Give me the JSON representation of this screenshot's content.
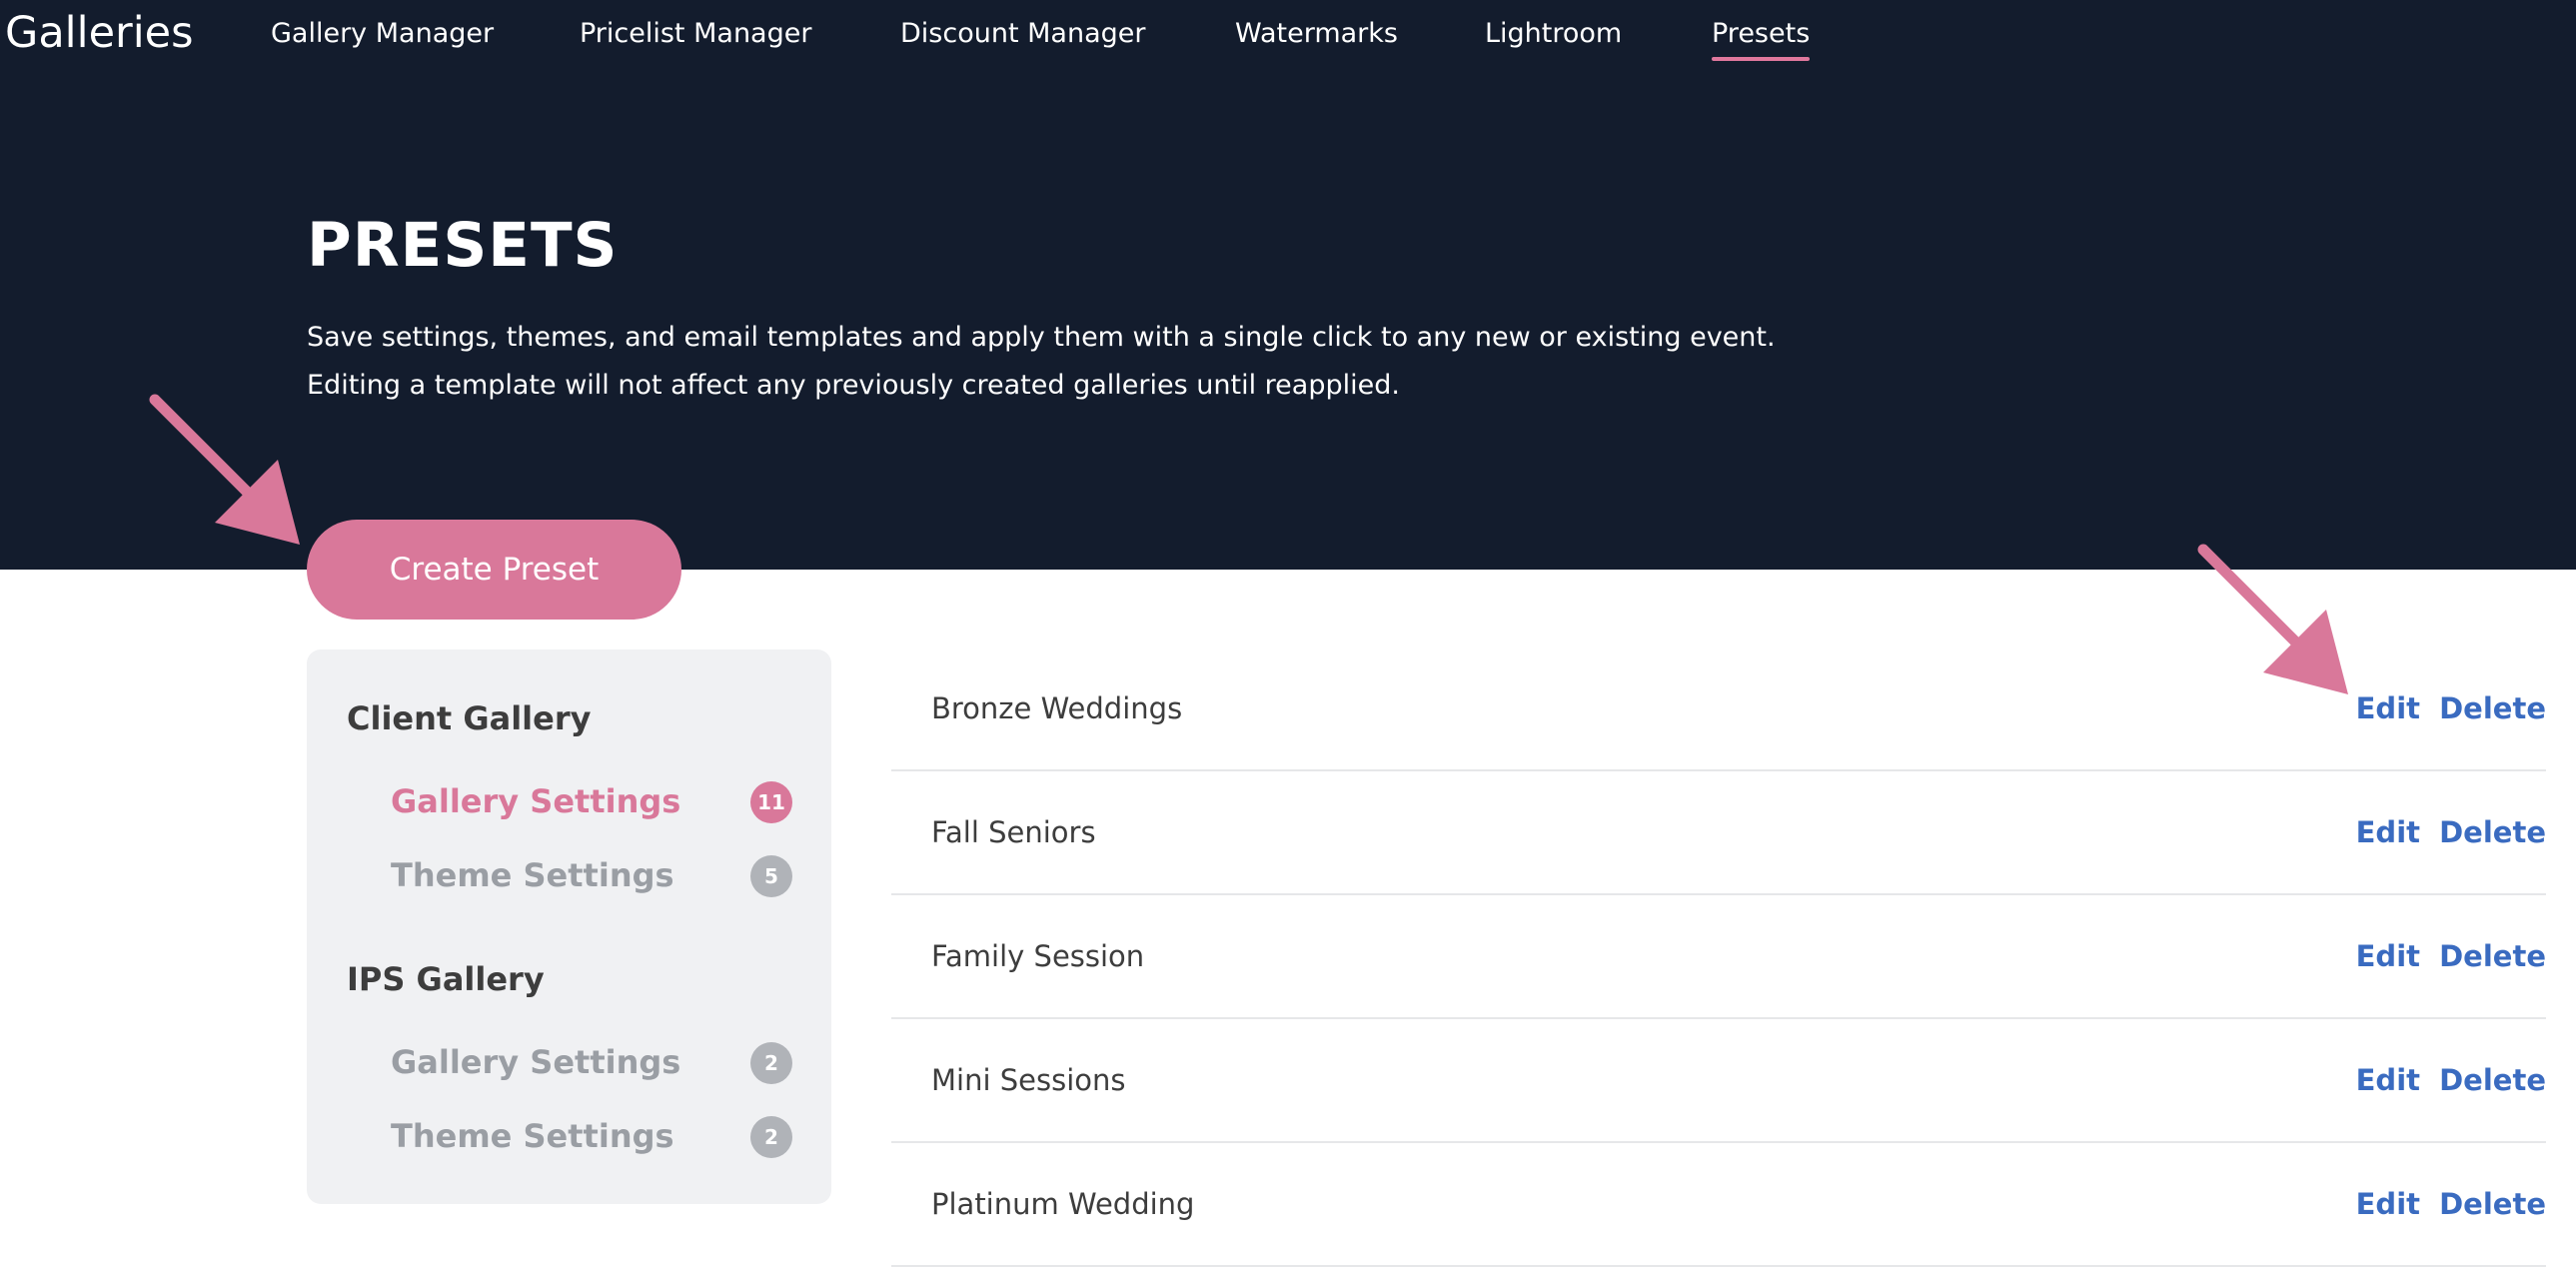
{
  "brand": "Galleries",
  "nav": [
    {
      "label": "Gallery Manager"
    },
    {
      "label": "Pricelist Manager"
    },
    {
      "label": "Discount Manager"
    },
    {
      "label": "Watermarks"
    },
    {
      "label": "Lightroom"
    },
    {
      "label": "Presets",
      "active": true
    }
  ],
  "page": {
    "title": "PRESETS",
    "description_line1": "Save settings, themes, and email templates and apply them with a single click to any new or existing event.",
    "description_line2": "Editing a template will not affect any previously created galleries until reapplied.",
    "create_label": "Create Preset"
  },
  "sidebar": {
    "groups": [
      {
        "heading": "Client Gallery",
        "items": [
          {
            "label": "Gallery Settings",
            "count": "11",
            "active": true
          },
          {
            "label": "Theme Settings",
            "count": "5"
          }
        ]
      },
      {
        "heading": "IPS Gallery",
        "items": [
          {
            "label": "Gallery Settings",
            "count": "2"
          },
          {
            "label": "Theme Settings",
            "count": "2"
          }
        ]
      }
    ]
  },
  "presets": [
    {
      "name": "Bronze Weddings",
      "edit": "Edit",
      "delete": "Delete"
    },
    {
      "name": "Fall Seniors",
      "edit": "Edit",
      "delete": "Delete"
    },
    {
      "name": "Family Session",
      "edit": "Edit",
      "delete": "Delete"
    },
    {
      "name": "Mini Sessions",
      "edit": "Edit",
      "delete": "Delete"
    },
    {
      "name": "Platinum Wedding",
      "edit": "Edit",
      "delete": "Delete"
    }
  ],
  "colors": {
    "header_bg": "#131c2d",
    "accent_pink": "#d9789a",
    "link_blue": "#3a6bc0",
    "sidebar_bg": "#f0f1f3"
  },
  "annotations": [
    "arrow-icon",
    "arrow-icon"
  ]
}
